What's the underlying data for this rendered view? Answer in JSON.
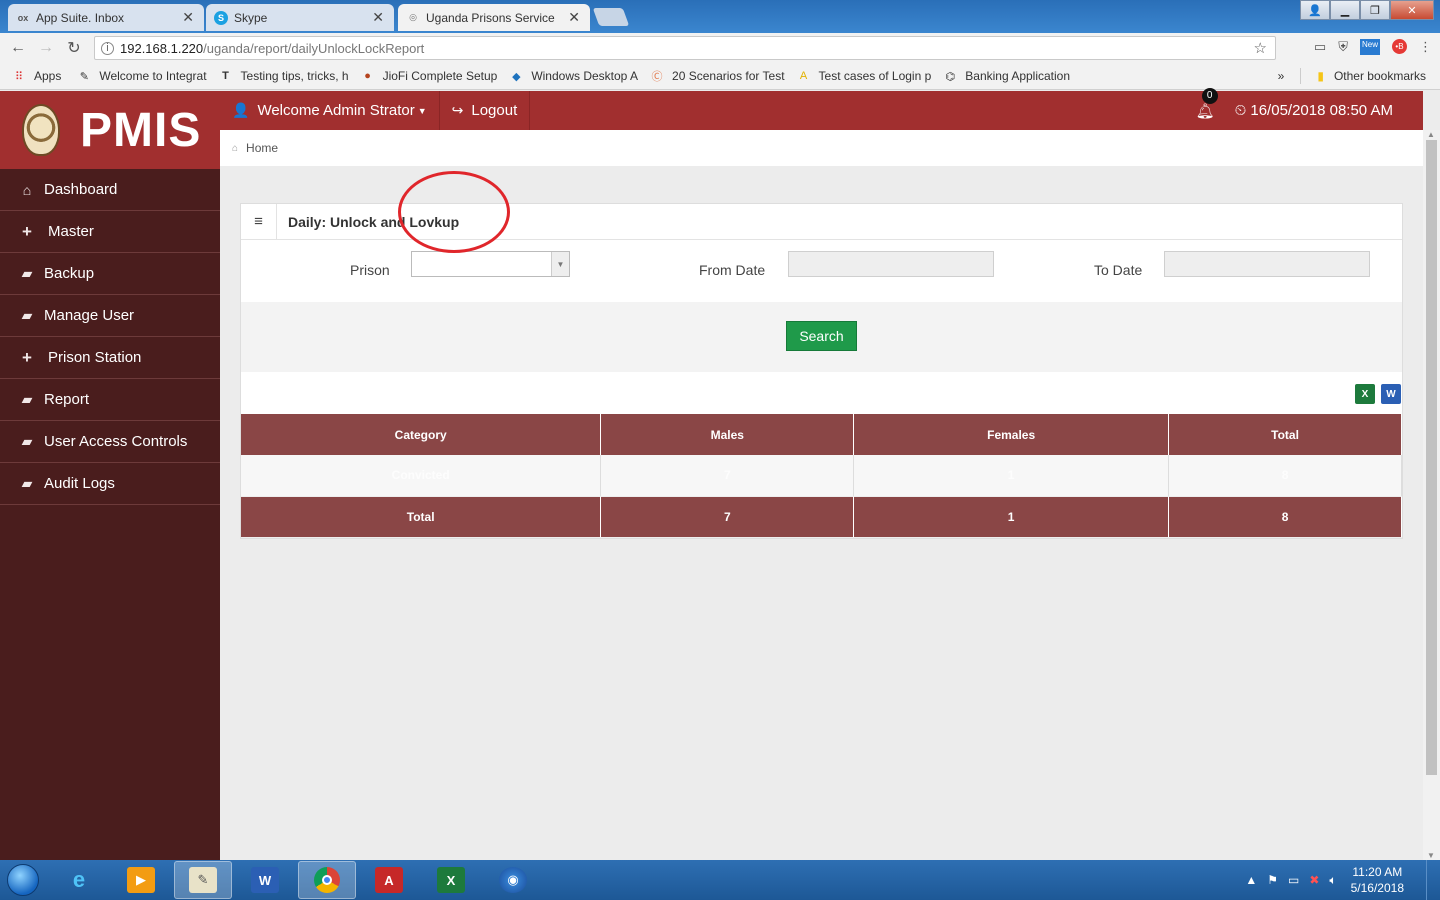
{
  "browser": {
    "tabs": [
      {
        "label": "App Suite. Inbox",
        "icon": "ox"
      },
      {
        "label": "Skype",
        "icon": "S"
      },
      {
        "label": "Uganda Prisons Service",
        "icon": "globe"
      }
    ],
    "url_host": "192.168.1.220",
    "url_path": "/uganda/report/dailyUnlockLockReport",
    "bookmarks": [
      {
        "label": "Apps"
      },
      {
        "label": "Welcome to Integrat"
      },
      {
        "label": "Testing tips, tricks, h"
      },
      {
        "label": "JioFi Complete Setup"
      },
      {
        "label": "Windows Desktop A"
      },
      {
        "label": "20 Scenarios for Test"
      },
      {
        "label": "Test cases of Login p"
      },
      {
        "label": "Banking Application"
      }
    ],
    "more_bookmarks": "»",
    "other_bookmarks": "Other bookmarks"
  },
  "app": {
    "brand": "PMIS",
    "sidebar": [
      {
        "label": "Dashboard",
        "icon": "home-icon"
      },
      {
        "label": "Master",
        "icon": "plus-icon"
      },
      {
        "label": "Backup",
        "icon": "folder-icon"
      },
      {
        "label": "Manage User",
        "icon": "folder-icon"
      },
      {
        "label": "Prison Station",
        "icon": "plus-icon"
      },
      {
        "label": "Report",
        "icon": "folder-icon"
      },
      {
        "label": "User Access Controls",
        "icon": "folder-icon"
      },
      {
        "label": "Audit Logs",
        "icon": "folder-icon"
      }
    ],
    "user_menu": "Welcome Admin Strator",
    "logout": "Logout",
    "notifications_count": "0",
    "datetime": "16/05/2018 08:50 AM",
    "breadcrumb": "Home"
  },
  "report": {
    "title": "Daily: Unlock and Lovkup",
    "filters": {
      "prison_label": "Prison",
      "prison_value": "",
      "from_label": "From Date",
      "from_value": "",
      "to_label": "To Date",
      "to_value": ""
    },
    "search_label": "Search",
    "export": {
      "excel": "X",
      "word": "W"
    },
    "table": {
      "headers": [
        "Category",
        "Males",
        "Females",
        "Total"
      ],
      "rows": [
        [
          "Convicted",
          "7",
          "1",
          "8"
        ]
      ],
      "total": [
        "Total",
        "7",
        "1",
        "8"
      ]
    }
  },
  "taskbar": {
    "time": "11:20 AM",
    "date": "5/16/2018"
  },
  "colors": {
    "primary_red": "#a12f2f",
    "sidebar_dark": "#4a1d1d",
    "table_header": "#8a4646",
    "search_green": "#1f9a4a",
    "annotation_circle": "#e0262b"
  }
}
